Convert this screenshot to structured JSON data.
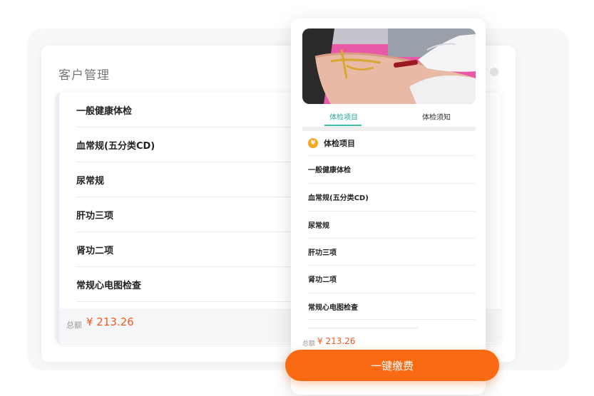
{
  "left_panel": {
    "title": "客户管理",
    "items": [
      "一般健康体检",
      "血常规(五分类CD)",
      "尿常规",
      "肝功三项",
      "肾功二项",
      "常规心电图检查"
    ],
    "total_label": "总额",
    "total_amount": "¥ 213.26"
  },
  "phone": {
    "tabs": [
      "体检项目",
      "体检须知"
    ],
    "active_tab": 0,
    "section_icon": "coin-icon",
    "section_title": "体检项目",
    "items": [
      "一般健康体检",
      "血常规(五分类CD)",
      "尿常规",
      "肝功三项",
      "肾功二项",
      "常规心电图检查"
    ],
    "total_label": "总额",
    "total_amount": "¥ 213.26"
  },
  "pay_button": {
    "label": "一键缴费"
  },
  "colors": {
    "accent_teal": "#2fa99a",
    "price_orange": "#f25a21",
    "button_orange": "#f96a13",
    "badge_gold": "#f5a623"
  }
}
